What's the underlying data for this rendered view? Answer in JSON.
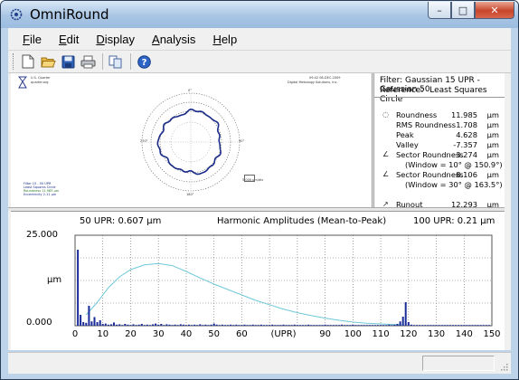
{
  "window": {
    "title": "OmniRound",
    "controls": {
      "minimize": "–",
      "maximize": "□",
      "close": "✕"
    }
  },
  "menu": [
    {
      "label": "File",
      "accel": "F",
      "rest": "ile"
    },
    {
      "label": "Edit",
      "accel": "E",
      "rest": "dit"
    },
    {
      "label": "Display",
      "accel": "D",
      "rest": "isplay"
    },
    {
      "label": "Analysis",
      "accel": "A",
      "rest": "nalysis"
    },
    {
      "label": "Help",
      "accel": "H",
      "rest": "elp"
    }
  ],
  "toolbar": {
    "icons": [
      "new-file-icon",
      "open-folder-icon",
      "save-disk-icon",
      "print-icon",
      "copy-icon",
      "help-icon"
    ]
  },
  "report": {
    "company": "U.S. Quarter",
    "company_sub": "quarter.org",
    "header_right_1": "09:42  08-DEC-2009",
    "header_right_2": "Digital Metrology Solutions, Inc.",
    "scale_label": "5.000 µm/div",
    "left_lines": [
      "Filter 15 - 50 UPR",
      "Least Squares Circle",
      "Roundness 11.985 µm",
      "Eccentricity 2.11 µm"
    ]
  },
  "results": {
    "filter_label": "Filter:",
    "filter_value": "Gaussian 15 UPR - Gaussian 50",
    "reference_label": "Reference:",
    "reference_value": "Least Squares Circle",
    "rows": [
      {
        "label": "Roundness",
        "value": "11.985",
        "unit": "µm"
      },
      {
        "label": "RMS Roundness",
        "value": "1.708",
        "unit": "µm"
      },
      {
        "label": "Peak",
        "value": "4.628",
        "unit": "µm"
      },
      {
        "label": "Valley",
        "value": "-7.357",
        "unit": "µm"
      },
      {
        "label": "Sector Roundness",
        "value": "3.274",
        "unit": "µm"
      },
      {
        "label": "Sector Roundness",
        "value": "8.106",
        "unit": "µm"
      },
      {
        "label": "Runout",
        "value": "12.293",
        "unit": "µm"
      }
    ],
    "sector1_window": "(Window = 10°  @ 150.9°)",
    "sector2_window": "(Window = 30°  @ 163.5°)"
  },
  "chart_data": {
    "type": "bar",
    "title": "Harmonic Amplitudes (Mean-to-Peak)",
    "left_note": "50 UPR:  0.607 µm",
    "right_note": "100 UPR:  0.21 µm",
    "xlabel": "(UPR)",
    "ylabel": "µm",
    "y_tick_top": "25.000",
    "y_tick_bottom": "0.000",
    "xlim": [
      0,
      150
    ],
    "ylim": [
      0,
      25
    ],
    "x_ticks": [
      0,
      10,
      20,
      30,
      40,
      50,
      60,
      90,
      100,
      110,
      120,
      130,
      140,
      150
    ],
    "bar_color": "#1a2c9a",
    "curve_color": "#6ec8d8",
    "bars": [
      [
        1,
        21.0
      ],
      [
        2,
        3.0
      ],
      [
        3,
        1.0
      ],
      [
        4,
        0.8
      ],
      [
        5,
        5.5
      ],
      [
        6,
        1.2
      ],
      [
        7,
        2.4
      ],
      [
        8,
        1.0
      ],
      [
        9,
        1.5
      ],
      [
        10,
        0.5
      ],
      [
        11,
        0.6
      ],
      [
        12,
        0.3
      ],
      [
        13,
        0.4
      ],
      [
        14,
        0.9
      ],
      [
        15,
        0.3
      ],
      [
        16,
        0.4
      ],
      [
        17,
        0.2
      ],
      [
        18,
        0.5
      ],
      [
        19,
        0.3
      ],
      [
        20,
        0.2
      ],
      [
        21,
        0.4
      ],
      [
        22,
        0.2
      ],
      [
        23,
        0.3
      ],
      [
        24,
        0.5
      ],
      [
        25,
        0.2
      ],
      [
        26,
        0.3
      ],
      [
        27,
        0.2
      ],
      [
        28,
        0.4
      ],
      [
        29,
        0.6
      ],
      [
        30,
        0.3
      ],
      [
        31,
        0.5
      ],
      [
        32,
        0.2
      ],
      [
        33,
        0.4
      ],
      [
        34,
        0.3
      ],
      [
        35,
        0.2
      ],
      [
        36,
        0.3
      ],
      [
        37,
        0.2
      ],
      [
        38,
        0.4
      ],
      [
        39,
        0.3
      ],
      [
        40,
        0.2
      ],
      [
        41,
        0.3
      ],
      [
        42,
        0.2
      ],
      [
        43,
        0.3
      ],
      [
        44,
        0.2
      ],
      [
        45,
        0.4
      ],
      [
        46,
        0.2
      ],
      [
        47,
        0.3
      ],
      [
        48,
        0.2
      ],
      [
        49,
        0.3
      ],
      [
        50,
        0.6
      ],
      [
        51,
        0.3
      ],
      [
        52,
        0.2
      ],
      [
        53,
        0.3
      ],
      [
        54,
        0.2
      ],
      [
        55,
        0.2
      ],
      [
        56,
        0.3
      ],
      [
        57,
        0.2
      ],
      [
        58,
        0.3
      ],
      [
        59,
        0.2
      ],
      [
        60,
        0.2
      ],
      [
        61,
        0.3
      ],
      [
        62,
        0.2
      ],
      [
        63,
        0.2
      ],
      [
        64,
        0.3
      ],
      [
        65,
        0.2
      ],
      [
        66,
        0.2
      ],
      [
        67,
        0.3
      ],
      [
        68,
        0.2
      ],
      [
        69,
        0.2
      ],
      [
        70,
        0.2
      ],
      [
        71,
        0.3
      ],
      [
        72,
        0.2
      ],
      [
        73,
        0.2
      ],
      [
        74,
        0.2
      ],
      [
        75,
        0.3
      ],
      [
        76,
        0.2
      ],
      [
        77,
        0.2
      ],
      [
        78,
        0.2
      ],
      [
        79,
        0.3
      ],
      [
        80,
        0.2
      ],
      [
        81,
        0.2
      ],
      [
        82,
        0.2
      ],
      [
        83,
        0.2
      ],
      [
        84,
        0.3
      ],
      [
        85,
        0.2
      ],
      [
        86,
        0.2
      ],
      [
        87,
        0.2
      ],
      [
        88,
        0.2
      ],
      [
        89,
        0.2
      ],
      [
        90,
        0.3
      ],
      [
        91,
        0.2
      ],
      [
        92,
        0.2
      ],
      [
        93,
        0.2
      ],
      [
        94,
        0.2
      ],
      [
        95,
        0.2
      ],
      [
        96,
        0.3
      ],
      [
        97,
        0.2
      ],
      [
        98,
        0.2
      ],
      [
        99,
        0.2
      ],
      [
        100,
        0.3
      ],
      [
        101,
        0.2
      ],
      [
        102,
        0.2
      ],
      [
        103,
        0.2
      ],
      [
        104,
        0.2
      ],
      [
        105,
        0.2
      ],
      [
        106,
        0.2
      ],
      [
        107,
        0.2
      ],
      [
        108,
        0.2
      ],
      [
        109,
        0.2
      ],
      [
        110,
        0.2
      ],
      [
        111,
        0.2
      ],
      [
        112,
        0.2
      ],
      [
        113,
        0.3
      ],
      [
        114,
        0.2
      ],
      [
        115,
        0.3
      ],
      [
        116,
        0.5
      ],
      [
        117,
        1.2
      ],
      [
        118,
        2.5
      ],
      [
        119,
        6.5
      ],
      [
        120,
        1.0
      ],
      [
        121,
        0.3
      ],
      [
        122,
        0.2
      ],
      [
        123,
        0.2
      ],
      [
        124,
        0.2
      ],
      [
        125,
        0.2
      ],
      [
        126,
        0.2
      ],
      [
        127,
        0.2
      ],
      [
        128,
        0.2
      ],
      [
        129,
        0.2
      ],
      [
        130,
        0.2
      ],
      [
        131,
        0.2
      ],
      [
        132,
        0.2
      ],
      [
        133,
        0.2
      ],
      [
        134,
        0.2
      ],
      [
        135,
        0.2
      ],
      [
        136,
        0.2
      ],
      [
        137,
        0.2
      ],
      [
        138,
        0.2
      ],
      [
        139,
        0.2
      ],
      [
        140,
        0.2
      ],
      [
        141,
        0.2
      ],
      [
        142,
        0.2
      ],
      [
        143,
        0.2
      ],
      [
        144,
        0.2
      ],
      [
        145,
        0.2
      ],
      [
        146,
        0.2
      ],
      [
        147,
        0.2
      ],
      [
        148,
        0.2
      ],
      [
        149,
        0.2
      ]
    ],
    "curve": [
      [
        4,
        3.0
      ],
      [
        8,
        6.5
      ],
      [
        12,
        10.5
      ],
      [
        16,
        13.5
      ],
      [
        20,
        15.5
      ],
      [
        25,
        16.8
      ],
      [
        30,
        17.2
      ],
      [
        35,
        16.6
      ],
      [
        40,
        15.0
      ],
      [
        45,
        13.2
      ],
      [
        50,
        11.5
      ],
      [
        55,
        10.0
      ],
      [
        60,
        8.5
      ],
      [
        65,
        7.0
      ],
      [
        70,
        5.8
      ],
      [
        75,
        4.6
      ],
      [
        80,
        3.6
      ],
      [
        85,
        2.8
      ],
      [
        90,
        2.1
      ],
      [
        95,
        1.5
      ],
      [
        100,
        1.0
      ],
      [
        105,
        0.7
      ],
      [
        110,
        0.5
      ],
      [
        115,
        0.3
      ],
      [
        118,
        0.2
      ]
    ]
  }
}
